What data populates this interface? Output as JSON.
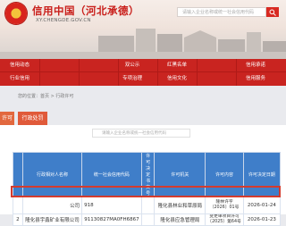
{
  "header": {
    "title": "信用中国（河北承德）",
    "url": "XY.CHENGDE.GOV.CN",
    "search_placeholder": "请输入企业名称或统一社会信用代码"
  },
  "nav": {
    "row1": [
      "信用动态",
      "",
      "",
      "双公示",
      "",
      "红黑名单",
      "",
      "信用承诺"
    ],
    "row2": [
      "行业信用",
      "",
      "",
      "专项治理",
      "",
      "信用文化",
      "",
      "信用服务"
    ]
  },
  "breadcrumb": "您的位置：首页 > 行政许可",
  "tabs": [
    "许可",
    "行政处罚"
  ],
  "list_search_placeholder": "请输入企业名称或统一社会信用代码",
  "table": {
    "headers": [
      "",
      "行政相对人名称",
      "统一社会信用代码",
      "许可决定书文号",
      "许可机关",
      "许可内容",
      "许可决定日期"
    ],
    "rows": [
      [
        "",
        "公司",
        "918",
        "",
        "隆化县林业和草原局",
        "隆林许字〔2026〕01号",
        "2026-01-24"
      ],
      [
        "2",
        "隆化县宇鑫矿业有限公司",
        "91130827MA0FH6867",
        "",
        "隆化县应急管理局",
        "变更单项目许可〔2025〕第64号",
        "2026-01-23"
      ]
    ]
  },
  "colors": {
    "brand_red": "#c92420",
    "table_header": "#3f7ec9",
    "tab_orange": "#e2683e"
  }
}
